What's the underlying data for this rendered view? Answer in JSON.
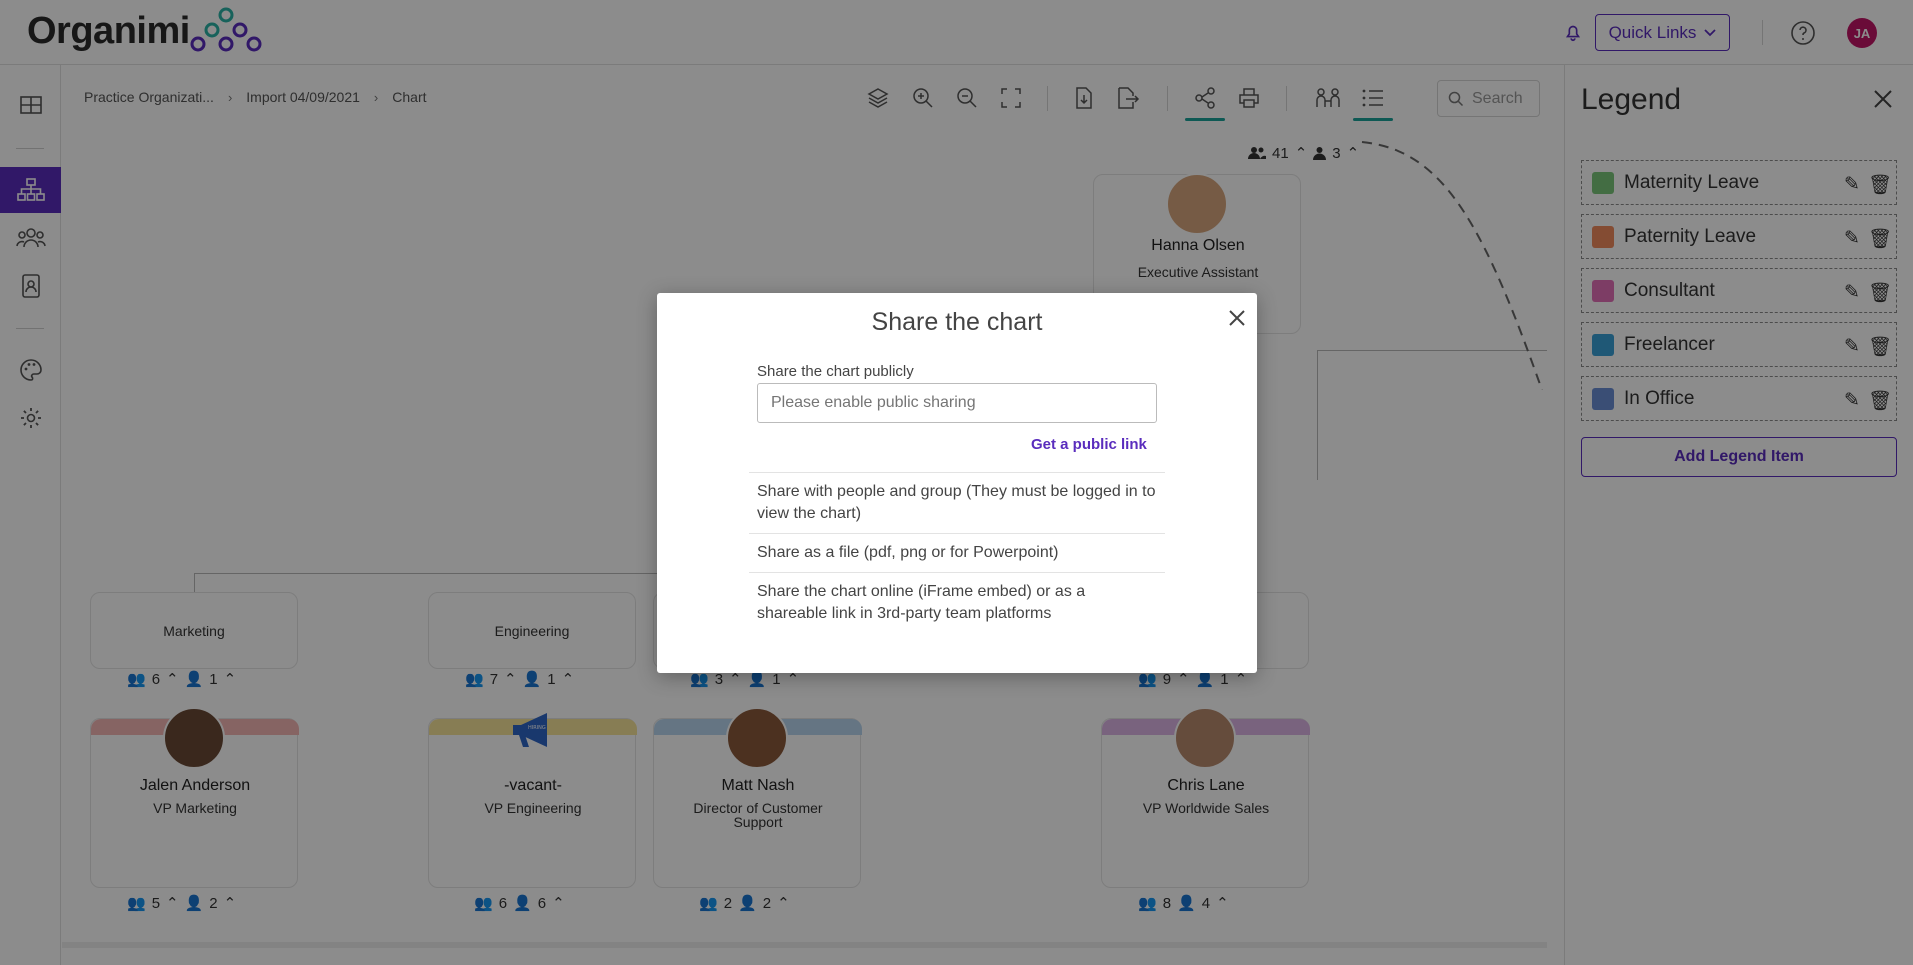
{
  "header": {
    "logo_text": "Organimi",
    "quick_links_label": "Quick Links",
    "avatar_initials": "JA"
  },
  "breadcrumb": {
    "items": [
      "Practice Organizati...",
      "Import 04/09/2021",
      "Chart"
    ]
  },
  "toolbar": {
    "search_placeholder": "Search"
  },
  "chart": {
    "top_counts": {
      "team": "41",
      "direct": "3"
    },
    "hanna": {
      "name": "Hanna Olsen",
      "title": "Executive Assistant"
    },
    "departments": [
      {
        "name": "Marketing",
        "team": "6",
        "direct": "1"
      },
      {
        "name": "Engineering",
        "team": "7",
        "direct": "1"
      },
      {
        "name": "",
        "team": "3",
        "direct": "1"
      },
      {
        "name": "",
        "team": "9",
        "direct": "1"
      }
    ],
    "people": [
      {
        "name": "Jalen Anderson",
        "title": "VP Marketing",
        "team": "5",
        "direct": "2",
        "band": "#f4b6b4"
      },
      {
        "name": "-vacant-",
        "title": "VP Engineering",
        "team": "6",
        "direct": "6",
        "band": "#f6e39a"
      },
      {
        "name": "Matt Nash",
        "title": "Director of Customer Support",
        "team": "2",
        "direct": "2",
        "band": "#b9d6ef"
      },
      {
        "name": "Chris Lane",
        "title": "VP Worldwide Sales",
        "team": "8",
        "direct": "4",
        "band": "#dcb4e6"
      }
    ],
    "vacant_badge": "WE'RE HIRING!"
  },
  "legend": {
    "title": "Legend",
    "items": [
      {
        "label": "Maternity Leave",
        "color": "#7bc67a"
      },
      {
        "label": "Paternity Leave",
        "color": "#f08a5d"
      },
      {
        "label": "Consultant",
        "color": "#e36fb8"
      },
      {
        "label": "Freelancer",
        "color": "#3aa0d8"
      },
      {
        "label": "In Office",
        "color": "#6b8fd6"
      }
    ],
    "add_label": "Add Legend Item"
  },
  "modal": {
    "title": "Share the chart",
    "public_label": "Share the chart publicly",
    "public_placeholder": "Please enable public sharing",
    "public_link_label": "Get a public link",
    "options": [
      "Share with people and group (They must be logged in to view the chart)",
      "Share as a file (pdf, png or for Powerpoint)",
      "Share the chart online (iFrame embed) or as a shareable link in 3rd-party team platforms"
    ]
  },
  "colors": {
    "brand": "#5a2dbd",
    "accent_teal": "#1aa39a",
    "avatar_bg": "#c21566"
  }
}
